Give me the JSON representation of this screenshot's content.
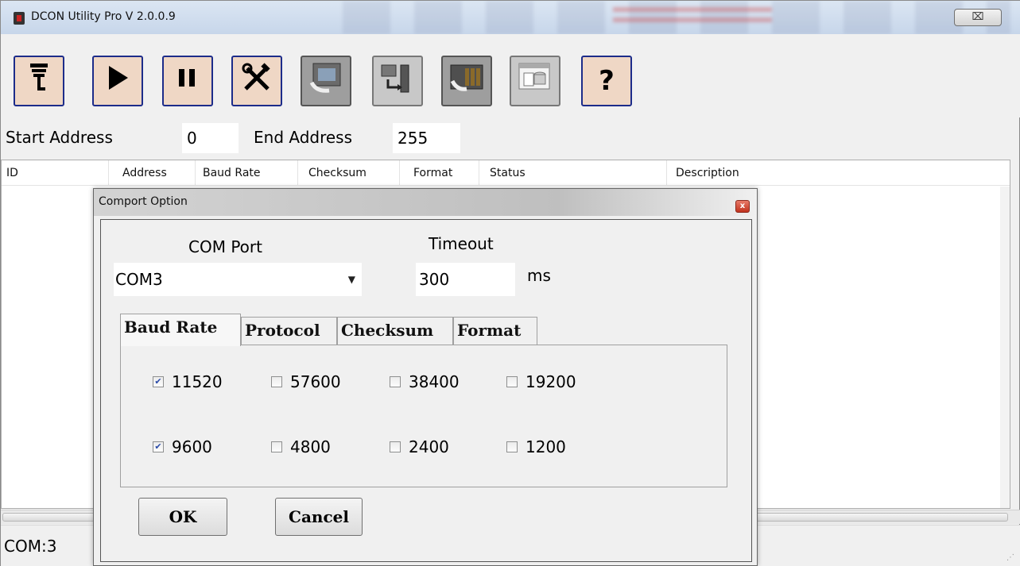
{
  "window": {
    "title": "DCON Utility Pro V 2.0.0.9",
    "close_glyph": "⌧"
  },
  "toolbar": {
    "buttons": [
      {
        "name": "search-icon",
        "glyph": "🔍"
      },
      {
        "name": "play-icon",
        "glyph": "▶"
      },
      {
        "name": "pause-icon",
        "glyph": "❚❚"
      },
      {
        "name": "tools-icon",
        "glyph": "✖"
      },
      {
        "name": "module-config-icon",
        "glyph": ""
      },
      {
        "name": "load-file-icon",
        "glyph": ""
      },
      {
        "name": "rack-module-icon",
        "glyph": ""
      },
      {
        "name": "database-window-icon",
        "glyph": ""
      },
      {
        "name": "help-icon",
        "glyph": "?"
      }
    ]
  },
  "address": {
    "start_label": "Start Address",
    "start_value": "0",
    "end_label": "End Address",
    "end_value": "255"
  },
  "list": {
    "columns": [
      "ID",
      "Address",
      "Baud Rate",
      "Checksum",
      "Format",
      "Status",
      "Description"
    ]
  },
  "statusbar": {
    "text": "COM:3"
  },
  "dialog": {
    "title": "Comport Option",
    "close_glyph": "x",
    "com_port_label": "COM Port",
    "com_port_value": "COM3",
    "timeout_label": "Timeout",
    "timeout_value": "300",
    "timeout_unit": "ms",
    "tabs": [
      "Baud Rate",
      "Protocol",
      "Checksum",
      "Format"
    ],
    "active_tab": "Baud Rate",
    "baud_rates": [
      {
        "label": "11520",
        "checked": true
      },
      {
        "label": "57600",
        "checked": false
      },
      {
        "label": "38400",
        "checked": false
      },
      {
        "label": "19200",
        "checked": false
      },
      {
        "label": "9600",
        "checked": true
      },
      {
        "label": "4800",
        "checked": false
      },
      {
        "label": "2400",
        "checked": false
      },
      {
        "label": "1200",
        "checked": false
      }
    ],
    "ok_label": "OK",
    "cancel_label": "Cancel"
  }
}
